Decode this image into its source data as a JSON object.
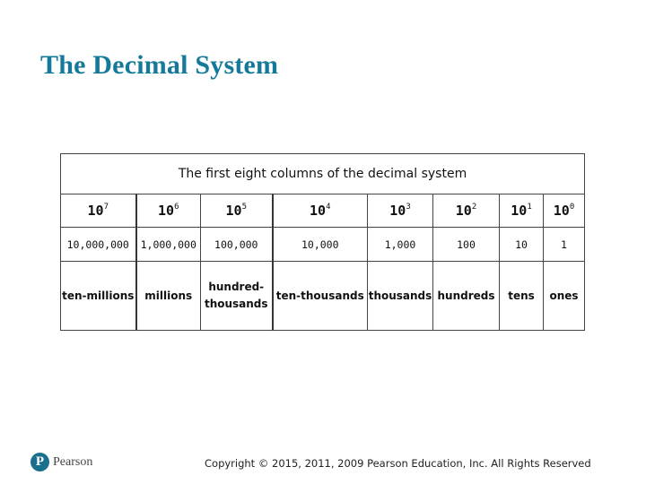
{
  "slide": {
    "title": "The Decimal System"
  },
  "table": {
    "caption": "The first eight columns of the decimal system",
    "columns": [
      {
        "base": "10",
        "exp": "7",
        "value": "10,000,000",
        "name": "ten-millions"
      },
      {
        "base": "10",
        "exp": "6",
        "value": "1,000,000",
        "name": "millions"
      },
      {
        "base": "10",
        "exp": "5",
        "value": "100,000",
        "name_line1": "hundred-",
        "name_line2": "thousands"
      },
      {
        "base": "10",
        "exp": "4",
        "value": "10,000",
        "name": "ten-thousands"
      },
      {
        "base": "10",
        "exp": "3",
        "value": "1,000",
        "name": "thousands"
      },
      {
        "base": "10",
        "exp": "2",
        "value": "100",
        "name": "hundreds"
      },
      {
        "base": "10",
        "exp": "1",
        "value": "10",
        "name": "tens"
      },
      {
        "base": "10",
        "exp": "0",
        "value": "1",
        "name": "ones"
      }
    ]
  },
  "footer": {
    "logo_glyph": "P",
    "logo_text": "Pearson",
    "logo_icon": "pearson-logo-icon",
    "copyright": "Copyright © 2015, 2011, 2009 Pearson Education, Inc. All Rights Reserved"
  },
  "colors": {
    "title": "#157a99",
    "logo": "#1a6f8c"
  }
}
